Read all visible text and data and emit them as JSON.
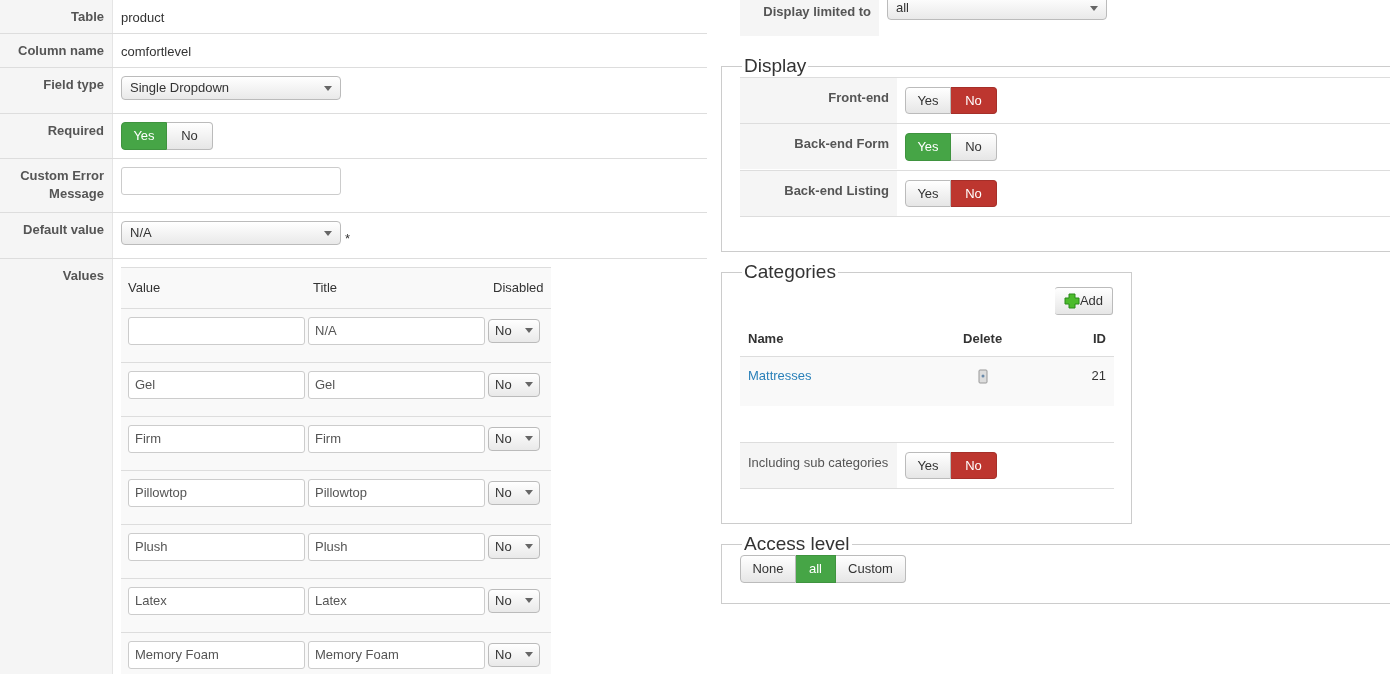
{
  "fields": [
    {
      "label": "Table",
      "kind": "text",
      "value": "product"
    },
    {
      "label": "Column name",
      "kind": "text",
      "value": "comfortlevel"
    },
    {
      "label": "Field type",
      "kind": "select",
      "value": "Single Dropdown"
    },
    {
      "label": "Required",
      "kind": "toggle",
      "options": [
        {
          "label": "Yes",
          "selected": true
        },
        {
          "label": "No",
          "selected": false
        }
      ]
    },
    {
      "label": "Custom Error Message",
      "kind": "input"
    },
    {
      "label": "Default value",
      "kind": "select",
      "value": "N/A",
      "note": "*"
    }
  ],
  "values": {
    "label": "Values",
    "columns": [
      "Value",
      "Title",
      "Disabled"
    ],
    "rows": [
      {
        "title": "N/A",
        "disabled": "No"
      },
      {
        "value": "Gel",
        "title": "Gel",
        "disabled": "No"
      },
      {
        "value": "Firm",
        "title": "Firm",
        "disabled": "No"
      },
      {
        "value": "Pillowtop",
        "title": "Pillowtop",
        "disabled": "No"
      },
      {
        "value": "Plush",
        "title": "Plush",
        "disabled": "No"
      },
      {
        "value": "Latex",
        "title": "Latex",
        "disabled": "No"
      },
      {
        "value": "Memory Foam",
        "title": "Memory Foam",
        "disabled": "No"
      }
    ]
  },
  "display_limited": {
    "label": "Display limited to",
    "value": "all"
  },
  "display": {
    "legend": "Display",
    "rows": [
      {
        "label": "Front-end",
        "options": [
          {
            "label": "Yes",
            "selected": false
          },
          {
            "label": "No",
            "selected": true
          }
        ]
      },
      {
        "label": "Back-end Form",
        "options": [
          {
            "label": "Yes",
            "selected": true
          },
          {
            "label": "No",
            "selected": false
          }
        ]
      },
      {
        "label": "Back-end Listing",
        "options": [
          {
            "label": "Yes",
            "selected": false
          },
          {
            "label": "No",
            "selected": true
          }
        ]
      }
    ]
  },
  "categories": {
    "legend": "Categories",
    "add_button": "Add",
    "columns": [
      "Name",
      "Delete",
      "ID"
    ],
    "rows": [
      {
        "name": "Mattresses",
        "id": "21"
      }
    ],
    "sub": {
      "label": "Including sub categories",
      "options": [
        {
          "label": "Yes",
          "selected": false
        },
        {
          "label": "No",
          "selected": true
        }
      ]
    }
  },
  "access": {
    "legend": "Access level",
    "options": [
      {
        "label": "None",
        "selected": false
      },
      {
        "label": "all",
        "selected": true
      },
      {
        "label": "Custom",
        "selected": false
      }
    ]
  }
}
